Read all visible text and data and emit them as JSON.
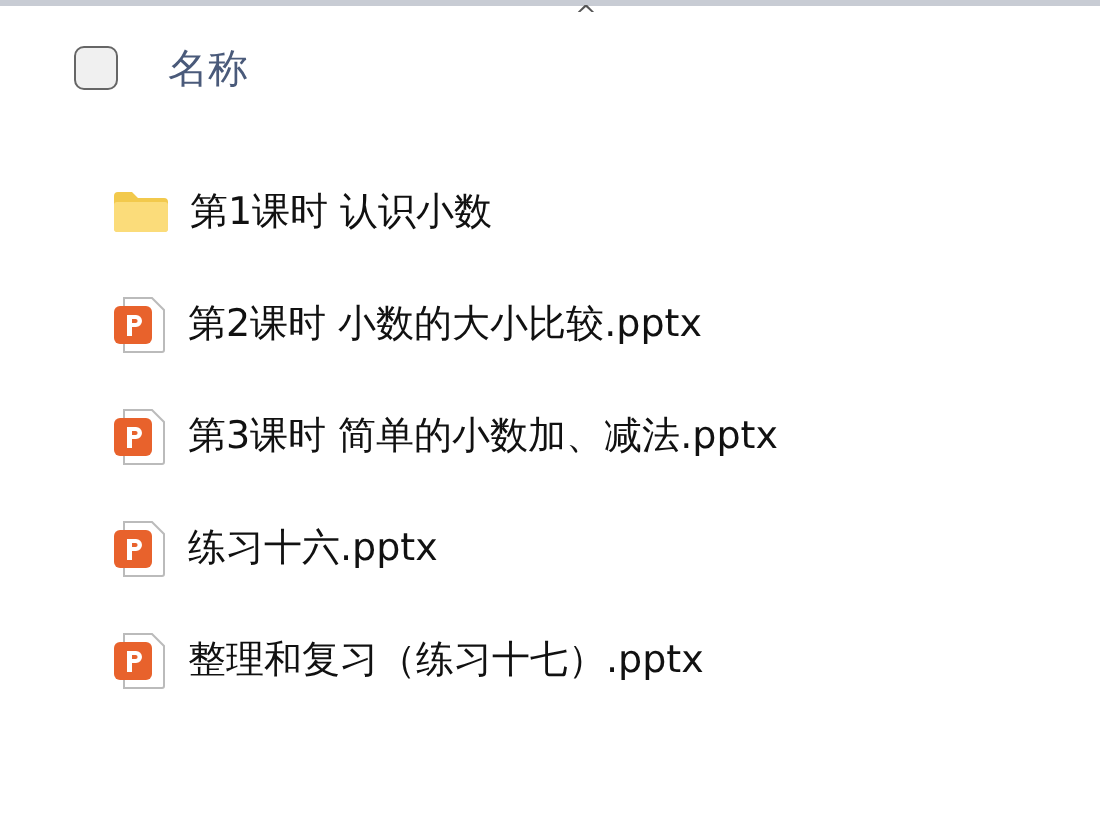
{
  "header": {
    "sort_indicator": "^",
    "select_all_checked": false,
    "column_title": "名称"
  },
  "files": [
    {
      "kind": "folder",
      "name": "第1课时 认识小数"
    },
    {
      "kind": "pptx",
      "name": "第2课时 小数的大小比较.pptx"
    },
    {
      "kind": "pptx",
      "name": "第3课时 简单的小数加、减法.pptx"
    },
    {
      "kind": "pptx",
      "name": "练习十六.pptx"
    },
    {
      "kind": "pptx",
      "name": "整理和复习（练习十七）.pptx"
    }
  ]
}
